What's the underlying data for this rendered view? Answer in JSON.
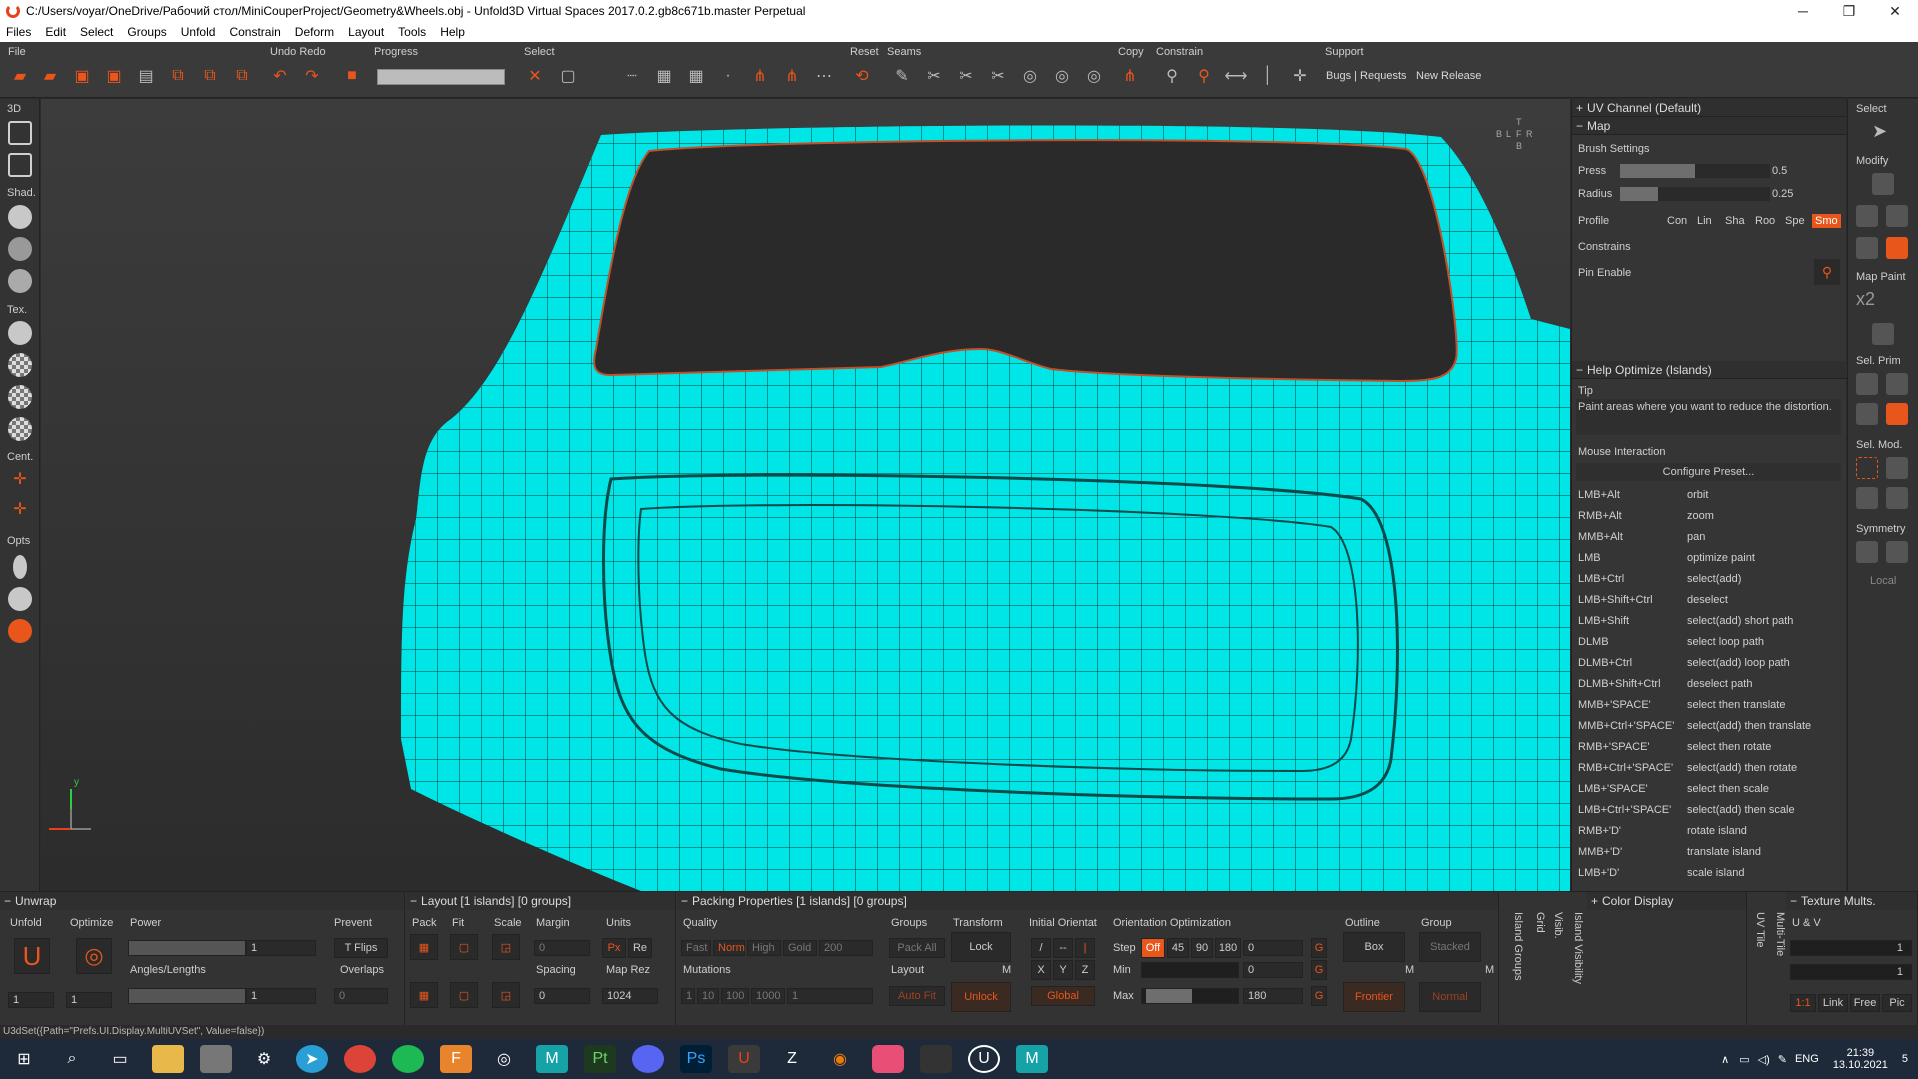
{
  "window": {
    "title": "C:/Users/voyar/OneDrive/Рабочий стол/MiniCouperProject/Geometry&Wheels.obj - Unfold3D Virtual Spaces 2017.0.2.gb8c671b.master Perpetual",
    "minimize": "─",
    "restore": "❐",
    "close": "✕"
  },
  "menu": [
    "Files",
    "Edit",
    "Select",
    "Groups",
    "Unfold",
    "Constrain",
    "Deform",
    "Layout",
    "Tools",
    "Help"
  ],
  "toolbar": {
    "labels": {
      "file": "File",
      "undo_redo": "Undo Redo",
      "progress": "Progress",
      "select": "Select",
      "reset": "Reset",
      "seams": "Seams",
      "copy": "Copy",
      "constrain": "Constrain",
      "support": "Support"
    },
    "support_links": [
      "Bugs | Requests",
      "New Release"
    ]
  },
  "left_toolbar": {
    "sections": [
      "3D",
      "Shad.",
      "Tex.",
      "Cent.",
      "Opts"
    ]
  },
  "viewport": {
    "nav_cube_letters": [
      "T",
      "B",
      "L",
      "F",
      "R",
      "B"
    ],
    "axis_y": "y"
  },
  "right_panel": {
    "uv_channel": "UV Channel (Default)",
    "map_header": "Map",
    "brush_settings": "Brush Settings",
    "press_label": "Press",
    "press_value": "0.5",
    "press_level": 0.5,
    "radius_label": "Radius",
    "radius_value": "0.25",
    "radius_level": 0.25,
    "profile_label": "Profile",
    "profiles": [
      "Con",
      "Lin",
      "Sha",
      "Roo",
      "Spe",
      "Smo"
    ],
    "active_profile": "Smo",
    "constrains": "Constrains",
    "pin_enable": "Pin Enable",
    "help_header": "Help Optimize (Islands)",
    "tip_label": "Tip",
    "tip_text": "Paint areas where you want to reduce the distortion.",
    "mouse_interaction": "Mouse Interaction",
    "configure_preset": "Configure Preset...",
    "bindings": [
      {
        "key": "LMB+Alt",
        "action": "orbit"
      },
      {
        "key": "RMB+Alt",
        "action": "zoom"
      },
      {
        "key": "MMB+Alt",
        "action": "pan"
      },
      {
        "key": "LMB",
        "action": "optimize paint"
      },
      {
        "key": "LMB+Ctrl",
        "action": "select(add)"
      },
      {
        "key": "LMB+Shift+Ctrl",
        "action": "deselect"
      },
      {
        "key": "LMB+Shift",
        "action": "select(add) short path"
      },
      {
        "key": "DLMB",
        "action": "select loop path"
      },
      {
        "key": "DLMB+Ctrl",
        "action": "select(add) loop path"
      },
      {
        "key": "DLMB+Shift+Ctrl",
        "action": "deselect path"
      },
      {
        "key": "MMB+'SPACE'",
        "action": "select then translate"
      },
      {
        "key": "MMB+Ctrl+'SPACE'",
        "action": "select(add) then translate"
      },
      {
        "key": "RMB+'SPACE'",
        "action": "select then rotate"
      },
      {
        "key": "RMB+Ctrl+'SPACE'",
        "action": "select(add) then rotate"
      },
      {
        "key": "LMB+'SPACE'",
        "action": "select then scale"
      },
      {
        "key": "LMB+Ctrl+'SPACE'",
        "action": "select(add) then scale"
      },
      {
        "key": "RMB+'D'",
        "action": "rotate island"
      },
      {
        "key": "MMB+'D'",
        "action": "translate island"
      },
      {
        "key": "LMB+'D'",
        "action": "scale island"
      }
    ]
  },
  "far_right": {
    "labels": [
      "Select",
      "Modify",
      "Map Paint",
      "Sel. Prim",
      "Sel. Mod.",
      "Symmetry",
      "Local"
    ],
    "x2": "x2"
  },
  "bottom": {
    "unwrap": {
      "title": "Unwrap",
      "unfold": "Unfold",
      "optimize": "Optimize",
      "power": "Power",
      "power_value": "1",
      "angles_lengths": "Angles/Lengths",
      "angles_value": "1",
      "prevent": "Prevent",
      "t_flips": "T Flips",
      "overlaps": "Overlaps",
      "overlaps_value": "0",
      "unfold_count": "1",
      "optimize_count": "1"
    },
    "layout": {
      "title": "Layout [1 islands] [0 groups]",
      "pack": "Pack",
      "fit": "Fit",
      "scale": "Scale",
      "margin": "Margin",
      "margin_value": "0",
      "spacing": "Spacing",
      "spacing_value": "0",
      "units": "Units",
      "px": "Px",
      "re": "Re",
      "map_rez": "Map Rez",
      "map_rez_value": "1024"
    },
    "packing": {
      "title": "Packing Properties [1 islands] [0 groups]",
      "quality": "Quality",
      "fast": "Fast",
      "norm": "Norm",
      "high": "High",
      "gold": "Gold",
      "gold_value": "200",
      "mutations": "Mutations",
      "mut_values": [
        "1",
        "10",
        "100",
        "1000",
        "1"
      ],
      "groups": "Groups",
      "pack_all": "Pack All",
      "layout": "Layout",
      "auto_fit": "Auto Fit",
      "transform": "Transform",
      "lock": "Lock",
      "unlock": "Unlock",
      "m": "M",
      "initial_orient": "Initial Orientat",
      "orient_symbols": [
        "/",
        "--",
        "|"
      ],
      "xyz": [
        "X",
        "Y",
        "Z"
      ],
      "global": "Global",
      "orient_opt": "Orientation Optimization",
      "step": "Step",
      "step_values": [
        "Off",
        "45",
        "90",
        "180",
        "0"
      ],
      "min": "Min",
      "min_value": "0",
      "max": "Max",
      "max_value": "180",
      "g": "G",
      "outline": "Outline",
      "box": "Box",
      "frontier": "Frontier",
      "group": "Group",
      "stacked": "Stacked",
      "normal": "Normal"
    },
    "side_tabs": [
      "Island Groups",
      "Grid",
      "Visib.",
      "Island Visibility"
    ],
    "color_display": "Color Display",
    "uv_tabs": [
      "UV Tile",
      "Multi-Tile"
    ],
    "texture": {
      "title": "Texture Mults.",
      "uv": "U & V",
      "val1": "1",
      "val2": "1",
      "ratio": "1:1",
      "link": "Link",
      "free": "Free",
      "pic": "Pic"
    }
  },
  "status_text": "U3dSet({Path=\"Prefs.UI.Display.MultiUVSet\", Value=false})",
  "taskbar": {
    "lang": "ENG",
    "time": "21:39",
    "date": "13.10.2021",
    "notif": "5"
  }
}
